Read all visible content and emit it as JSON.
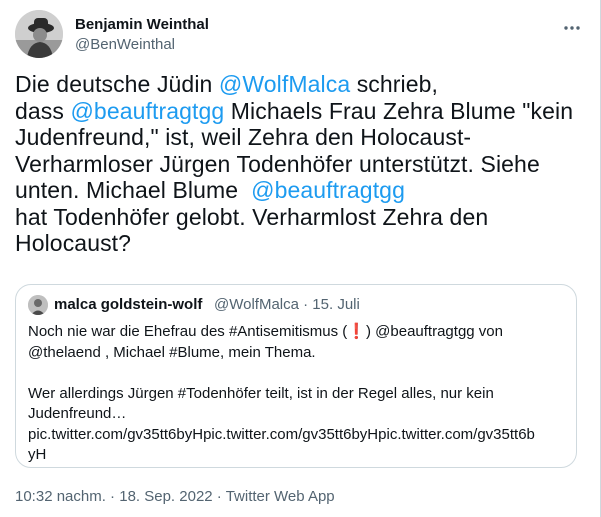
{
  "author": {
    "name": "Benjamin Weinthal",
    "handle": "@BenWeinthal"
  },
  "icons": {
    "more": "more-dots-icon",
    "avatar": "profile-photo",
    "quote_avatar": "profile-photo"
  },
  "tweet": {
    "lines": [
      [
        "Die deutsche Jüdin ",
        "@WolfMalca",
        " schrieb,"
      ],
      [
        "dass ",
        "@beauftragtgg",
        " Michaels Frau Zehra Blume \"kein"
      ],
      [
        "Judenfreund,\" ist, weil Zehra den Holocaust-"
      ],
      [
        "Verharmloser Jürgen Todenhöfer unterstützt. Siehe"
      ],
      [
        "unten. Michael Blume  ",
        "@beauftragtgg"
      ],
      [
        "hat Todenhöfer gelobt. Verharmlost Zehra den"
      ],
      [
        "Holocaust?"
      ]
    ]
  },
  "quote": {
    "name": "malca goldstein-wolf",
    "meta": "@WolfMalca · 15. Juli",
    "line1_a": "Noch nie war die Ehefrau des #Antisemitismus (",
    "line1_emoji": "❗",
    "line1_b": ") @beauftragtgg von",
    "line2": "@thelaend , Michael #Blume, mein Thema.",
    "line3": "Wer allerdings Jürgen #Todenhöfer teilt, ist in der Regel alles, nur kein",
    "line4": "Judenfreund…",
    "line5": "pic.twitter.com/gv35tt6byHpic.twitter.com/gv35tt6byHpic.twitter.com/gv35tt6b",
    "line6": "yH"
  },
  "footer": {
    "timestamp": "10:32 nachm. · 18. Sep. 2022 · Twitter Web App"
  },
  "colors": {
    "link": "#1d9bf0",
    "text": "#0f1419",
    "secondary": "#536471",
    "border": "#cfd9de"
  }
}
